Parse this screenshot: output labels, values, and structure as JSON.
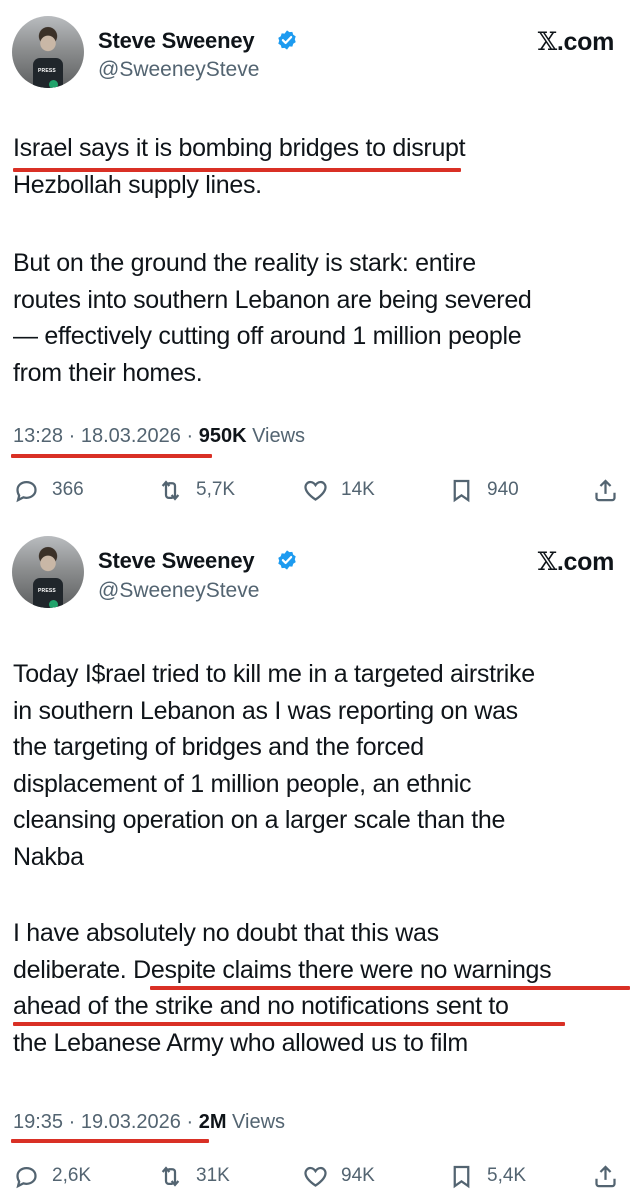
{
  "colors": {
    "highlight_underline": "#d93025",
    "secondary_text": "#536471",
    "verified_blue": "#1d9bf0"
  },
  "tweets": [
    {
      "author_name": "Steve Sweeney",
      "handle": "@SweeneySteve",
      "brand": ".com",
      "brand_mark": "𝕏",
      "avatar_badge": "PRESS",
      "paragraphs": [
        "Israel says it is bombing bridges to disrupt\nHezbollah supply lines.",
        "But on the ground the reality is stark: entire\nroutes into southern Lebanon are being severed\n— effectively cutting off around 1 million people\nfrom their homes."
      ],
      "timestamp": "13:28 · 18.03.2026 · ",
      "views_count": "950K",
      "views_label": " Views",
      "actions": {
        "replies": "366",
        "reposts": "5,7K",
        "likes": "14K",
        "bookmarks": "940"
      }
    },
    {
      "author_name": "Steve Sweeney",
      "handle": "@SweeneySteve",
      "brand": ".com",
      "brand_mark": "𝕏",
      "avatar_badge": "PRESS",
      "paragraphs": [
        "Today I$rael tried to kill me in a targeted airstrike\nin southern Lebanon as I was reporting on was\nthe targeting of bridges and the forced\ndisplacement of 1 million people, an ethnic\ncleansing operation on a larger scale than the\nNakba",
        "I have absolutely no doubt that this was\ndeliberate. Despite claims there were no warnings\nahead of the strike and no notifications sent to\nthe Lebanese Army who allowed us to film"
      ],
      "timestamp": "19:35 · 19.03.2026 · ",
      "views_count": "2M",
      "views_label": " Views",
      "actions": {
        "replies": "2,6K",
        "reposts": "31K",
        "likes": "94K",
        "bookmarks": "5,4K"
      }
    }
  ]
}
